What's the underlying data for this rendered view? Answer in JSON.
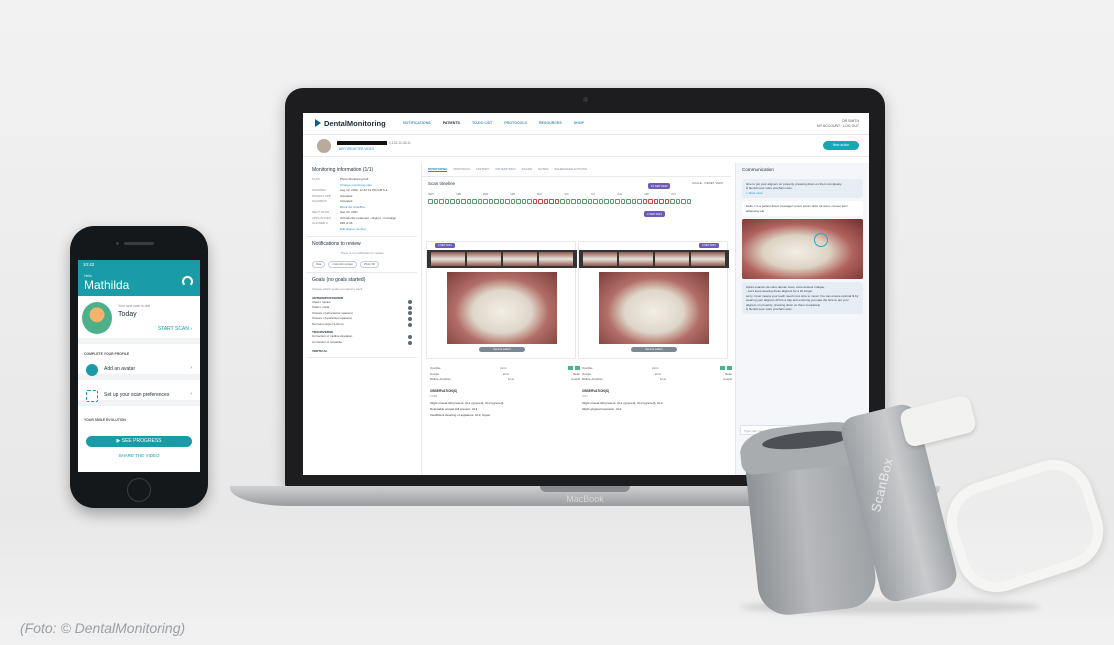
{
  "caption": "(Foto: © DentalMonitoring)",
  "laptop": {
    "model_label": "MacBook",
    "app": {
      "logo": "DentalMonitoring",
      "nav": [
        "NOTIFICATIONS",
        "PATIENTS",
        "TO-DO LIST",
        "PROTOCOLS",
        "RESOURCES",
        "SHOP"
      ],
      "user": {
        "name": "DR SMITH",
        "links": "MY ACCOUNT · LOG OUT"
      },
      "patient": {
        "id": "1-123-12-45-11",
        "sub_link": "BEFORE/AFTER VIDEO",
        "new_action": "New action"
      },
      "monitoring_card": {
        "title": "Monitoring information (1/1)",
        "rows": [
          {
            "k": "PLAN",
            "v": "Photo Monitoring Full"
          },
          {
            "k": "",
            "v": "Change monitoring plan"
          },
          {
            "k": "STARTED",
            "v": "Aug 10, 2020, 12:42:13 PM GMT+1"
          },
          {
            "k": "PATIENT APP",
            "v": "Activated"
          },
          {
            "k": "SCANBOX",
            "v": "Activated"
          },
          {
            "k": "",
            "v": "Block the ScanBox"
          },
          {
            "k": "NEXT SCAN",
            "v": "Sep 23, 2021"
          },
          {
            "k": "APPLIANCES",
            "v": "Orthodontic treatment - Aligner - Invisalign"
          },
          {
            "k": "ALIGNER #",
            "v": "#40 of 46"
          },
          {
            "k": "",
            "v": "Edit aligner number"
          }
        ]
      },
      "notifications_card": {
        "title": "Notifications to review",
        "note": "There is no notification to review",
        "chips": [
          "Note",
          "Instruction screen",
          "Photo 3D"
        ]
      },
      "goals_card": {
        "title": "Goals (no goals started)",
        "subtitle": "Choose which goals you want to track",
        "sections": [
          {
            "head": "ANTEROPOSTERIOR",
            "items": [
              "Class I canine",
              "Class I molar",
              "Closure of all anterior space(s)",
              "Closure of extraction space(s)",
              "Normal overjet (1-3mm)"
            ]
          },
          {
            "head": "TRANSVERSE",
            "items": [
              "Correction of midline deviation",
              "Correction of crossbite"
            ]
          },
          {
            "head": "VERTICAL",
            "items": []
          }
        ]
      },
      "tabs": [
        "MONITORING",
        "PROTOCOL",
        "HISTORY",
        "PATIENT INFO",
        "SCANS",
        "NOTES",
        "SCHEDULED ACTIONS"
      ],
      "timeline": {
        "title": "Scan timeline",
        "controls": "SCALE · RESET VIEW",
        "months": [
          "SEPT",
          "FEB",
          "MAR",
          "APR",
          "MAY",
          "JUN",
          "JUL",
          "AUG",
          "SEP",
          "OCT"
        ],
        "flags": [
          "16 SEP 2020",
          "9 SEP 2021"
        ]
      },
      "photo_panels": [
        {
          "flag": "9 SEP 2021",
          "button": "Send to patient",
          "measures": [
            [
              "Overbite",
              "1mm"
            ],
            [
              "Overjet",
              "2mm"
            ],
            [
              "Midline deviation",
              "1mm"
            ]
          ],
          "side_labels": [
            "Molar",
            "Cuspid"
          ],
          "obs_title": "OBSERVATION(S)",
          "obs_sub": "9 FEB",
          "observations": [
            "Slight unseat still present: UL1 (ignored), UL2 (ignored)",
            "Noticeable unseat still present: UL3",
            "Insufficient cleaning of appliance: UL3, Upper"
          ]
        },
        {
          "flag": "9 SEP 2021",
          "button": "Send to patient",
          "measures": [
            [
              "Overbite",
              "2mm"
            ],
            [
              "Overjet",
              "2mm"
            ],
            [
              "Midline deviation",
              "1mm"
            ]
          ],
          "side_labels": [
            "Molar",
            "Cuspid"
          ],
          "obs_title": "OBSERVATION(S)",
          "obs_sub": "2021",
          "observations": [
            "Slight unseat still present: UL1 (ignored), UL2 (ignored), UL3",
            "Slight gingival recession: UL2"
          ]
        }
      ],
      "communication": {
        "title": "Communication",
        "messages": [
          "time to put your aligners on properly, pressing down on them completely.",
          "À bientôt pour votre prochain scan.",
          "+ View more",
          "Hello, I'm a patient direct message! Lorem ipsum dolor sit amet, consec tetur adipiscing elit.",
          "Après examen de votre dernier scan, votre docteur indique :",
          "- Let's keep wearing these aligners for a bit longer.",
          "sorry, it just means your teeth need more time to move! You can ensure optimal fit by wearing your aligners 22 hrs a day and ensuring you take the time to put your aligners on properly, pressing down on them completely.",
          "À bientôt pour votre prochain scan."
        ],
        "input_placeholder": "Type your message here..."
      }
    }
  },
  "phone": {
    "time": "10:42",
    "hello": "Hello",
    "name": "Mathilda",
    "next_scan_label": "Your next scan is due",
    "next_scan_value": "Today",
    "start_scan": "START SCAN",
    "profile_section": "COMPLETE YOUR PROFILE",
    "profile_items": [
      "Add an avatar",
      "Set up your scan preferences"
    ],
    "evolution_section": "YOUR SMILE EVOLUTION",
    "see_progress": "SEE PROGRESS",
    "share_video": "SHARE THE VIDEO"
  },
  "scanbox": {
    "label": "ScanBox"
  },
  "colors": {
    "teal": "#1a9ba8",
    "purple_flag": "#6e5ab9",
    "brand_blue": "#0f5b8c"
  }
}
